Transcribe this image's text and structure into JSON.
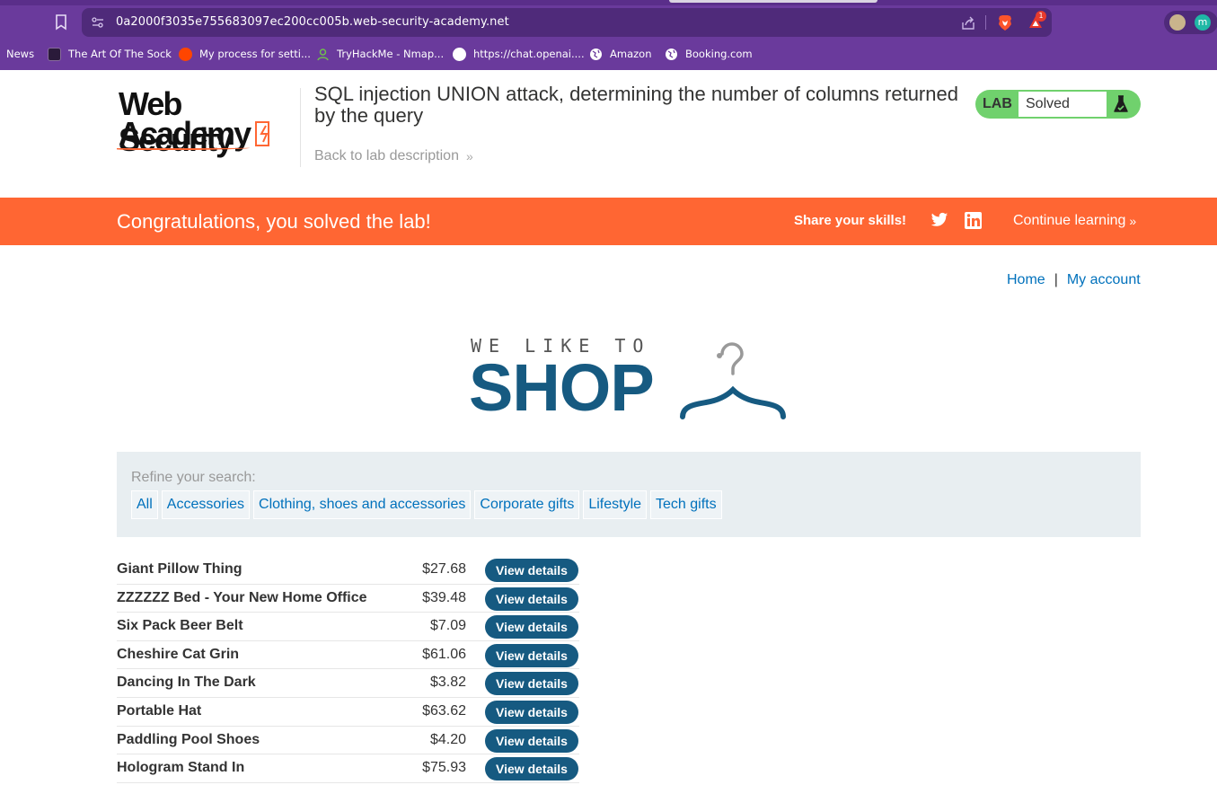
{
  "browser": {
    "url": "0a2000f3035e755683097ec200cc005b.web-security-academy.net",
    "rewards_badge": "1",
    "profile_initial": "m",
    "bookmarks": [
      {
        "label": "News",
        "icon": "news-icon",
        "color": "#6a3a9c"
      },
      {
        "label": "The Art Of The Sock",
        "icon": "sock-site-icon",
        "color": "#2a1a3a"
      },
      {
        "label": "My process for setti...",
        "icon": "reddit-icon",
        "color": "#ff4500"
      },
      {
        "label": "TryHackMe - Nmap...",
        "icon": "tryhackme-icon",
        "color": "#6fbf4c"
      },
      {
        "label": "https://chat.openai....",
        "icon": "openai-icon",
        "color": "#ffffff"
      },
      {
        "label": "Amazon",
        "icon": "globe-icon",
        "color": "#ffffff"
      },
      {
        "label": "Booking.com",
        "icon": "globe-icon",
        "color": "#ffffff"
      }
    ]
  },
  "academy": {
    "logo_line1": "Web Security",
    "logo_line2": "Academy",
    "lab_title": "SQL injection UNION attack, determining the number of columns returned by the query",
    "back_link": "Back to lab description",
    "status_label": "LAB",
    "status_value": "Solved",
    "status_color": "#70d16d"
  },
  "banner": {
    "message": "Congratulations, you solved the lab!",
    "share_label": "Share your skills!",
    "continue_label": "Continue learning",
    "color": "#ff6633"
  },
  "nav": {
    "home": "Home",
    "separator": "|",
    "account": "My account"
  },
  "shop_logo": {
    "small_text": "WE LIKE TO",
    "big_text": "SHOP"
  },
  "filters": {
    "label": "Refine your search:",
    "items": [
      "All",
      "Accessories",
      "Clothing, shoes and accessories",
      "Corporate gifts",
      "Lifestyle",
      "Tech gifts"
    ]
  },
  "products": {
    "button_label": "View details",
    "items": [
      {
        "name": "Giant Pillow Thing",
        "price": "$27.68"
      },
      {
        "name": "ZZZZZZ Bed - Your New Home Office",
        "price": "$39.48"
      },
      {
        "name": "Six Pack Beer Belt",
        "price": "$7.09"
      },
      {
        "name": "Cheshire Cat Grin",
        "price": "$61.06"
      },
      {
        "name": "Dancing In The Dark",
        "price": "$3.82"
      },
      {
        "name": "Portable Hat",
        "price": "$63.62"
      },
      {
        "name": "Paddling Pool Shoes",
        "price": "$4.20"
      },
      {
        "name": "Hologram Stand In",
        "price": "$75.93"
      }
    ]
  }
}
